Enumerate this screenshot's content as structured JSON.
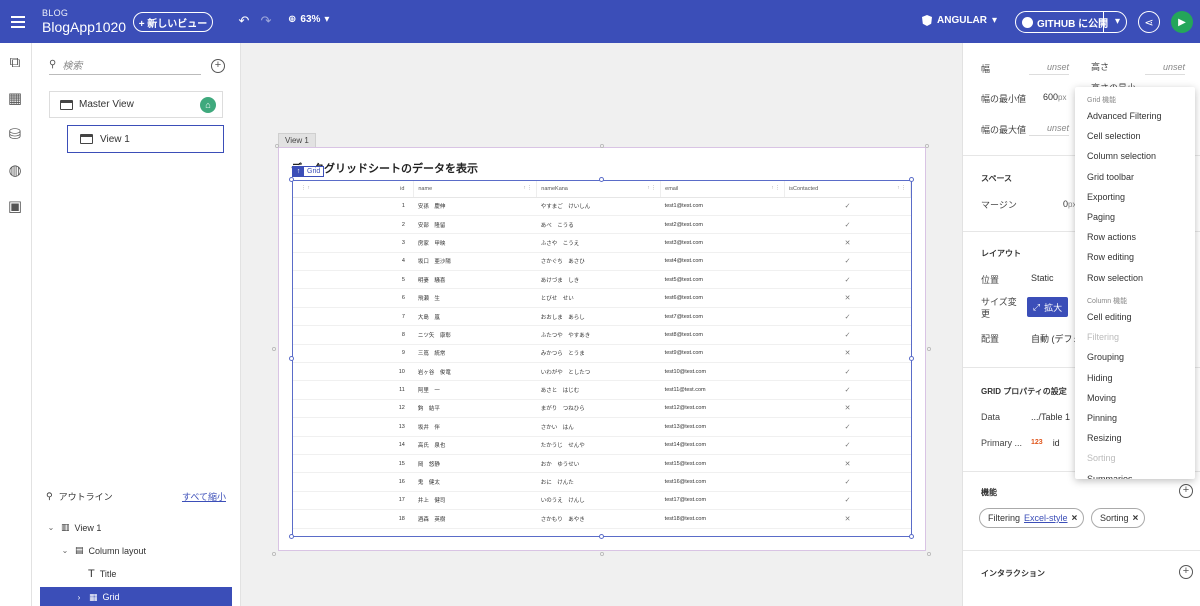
{
  "topbar": {
    "app_sub": "BLOG",
    "app_title": "BlogApp1020",
    "new_view": "+ 新しいビュー",
    "zoom": "63%",
    "framework": "ANGULAR",
    "publish": "GITHUB に公開"
  },
  "left": {
    "search_placeholder": "検索",
    "master_view": "Master View",
    "view1": "View 1",
    "outline_title": "アウトライン",
    "collapse_all": "すべて縮小",
    "tree": [
      "View 1",
      "Column layout",
      "Title",
      "Grid"
    ]
  },
  "canvas": {
    "view_tab": "View 1",
    "frame_title": "データグリッドシートのデータを表示",
    "grid_tag": "Grid",
    "columns": [
      "id",
      "name",
      "nameKana",
      "email",
      "isContacted"
    ],
    "rows": [
      {
        "id": "1",
        "name": "安孫　慶伸",
        "kana": "やすまご　けいしん",
        "email": "test1@test.com",
        "c": "✓"
      },
      {
        "id": "2",
        "name": "安部　隆留",
        "kana": "あべ　こうる",
        "email": "test2@test.com",
        "c": "✓"
      },
      {
        "id": "3",
        "name": "房家　甲映",
        "kana": "ふさや　こうえ",
        "email": "test3@test.com",
        "c": "✕"
      },
      {
        "id": "4",
        "name": "坂口　亜沙陽",
        "kana": "さかぐち　あさひ",
        "email": "test4@test.com",
        "c": "✓"
      },
      {
        "id": "5",
        "name": "明妻　騒喜",
        "kana": "あけづま　しき",
        "email": "test5@test.com",
        "c": "✓"
      },
      {
        "id": "6",
        "name": "飛瀬　生",
        "kana": "とびせ　せい",
        "email": "test6@test.com",
        "c": "✕"
      },
      {
        "id": "7",
        "name": "大島　嵐",
        "kana": "おおしま　あらし",
        "email": "test7@test.com",
        "c": "✓"
      },
      {
        "id": "8",
        "name": "ニツ矢　康彰",
        "kana": "ふたつや　やすあき",
        "email": "test8@test.com",
        "c": "✓"
      },
      {
        "id": "9",
        "name": "三嶌　統常",
        "kana": "みかつら　とうま",
        "email": "test9@test.com",
        "c": "✕"
      },
      {
        "id": "10",
        "name": "岩ヶ谷　俊竜",
        "kana": "いわがや　としたつ",
        "email": "test10@test.com",
        "c": "✓"
      },
      {
        "id": "11",
        "name": "阿里　一",
        "kana": "あさと　はじむ",
        "email": "test11@test.com",
        "c": "✓"
      },
      {
        "id": "12",
        "name": "鈎　結平",
        "kana": "まがり　つねひら",
        "email": "test12@test.com",
        "c": "✕"
      },
      {
        "id": "13",
        "name": "坂井　伴",
        "kana": "さかい　はん",
        "email": "test13@test.com",
        "c": "✓"
      },
      {
        "id": "14",
        "name": "高氏　泉也",
        "kana": "たかうじ　せんや",
        "email": "test14@test.com",
        "c": "✓"
      },
      {
        "id": "15",
        "name": "岡　悠静",
        "kana": "おか　ゆうせい",
        "email": "test15@test.com",
        "c": "✕"
      },
      {
        "id": "16",
        "name": "鬼　健太",
        "kana": "おに　けんた",
        "email": "test16@test.com",
        "c": "✓"
      },
      {
        "id": "17",
        "name": "井上　健司",
        "kana": "いのうえ　けんし",
        "email": "test17@test.com",
        "c": "✓"
      },
      {
        "id": "18",
        "name": "酒森　英樹",
        "kana": "さかもり　あやき",
        "email": "test18@test.com",
        "c": "✕"
      }
    ]
  },
  "right": {
    "width_label": "幅",
    "width_val": "unset",
    "height_label": "高さ",
    "height_val": "unset",
    "minh_label": "高さの最小",
    "minw_label": "幅の最小値",
    "minw_val": "600",
    "minw_unit": "px",
    "maxw_label": "幅の最大値",
    "maxw_val": "unset",
    "space_title": "スペース",
    "margin_label": "マージン",
    "margin_val": "0",
    "margin_unit": "px",
    "layout_title": "レイアウト",
    "position_label": "位置",
    "position_val": "Static",
    "resize_label": "サイズ変更",
    "expand_btn": "拡大",
    "arrange_label": "配置",
    "arrange_val": "自動 (デフォ",
    "grid_props_title": "GRID プロパティの設定",
    "data_label": "Data",
    "data_val": ".../Table 1",
    "primary_label": "Primary ...",
    "primary_badge": "123",
    "primary_val": "id",
    "features_title": "機能",
    "chip1_label": "Filtering",
    "chip1_link": "Excel-style",
    "chip2_label": "Sorting",
    "interaction_title": "インタラクション"
  },
  "dropdown": {
    "grid_group": "Grid 機能",
    "grid_items": [
      "Advanced Filtering",
      "Cell selection",
      "Column selection",
      "Grid toolbar",
      "Exporting",
      "Paging",
      "Row actions",
      "Row editing",
      "Row selection"
    ],
    "column_group": "Column 機能",
    "column_items": [
      "Cell editing",
      "Filtering",
      "Grouping",
      "Hiding",
      "Moving",
      "Pinning",
      "Resizing",
      "Sorting",
      "Summaries"
    ]
  }
}
